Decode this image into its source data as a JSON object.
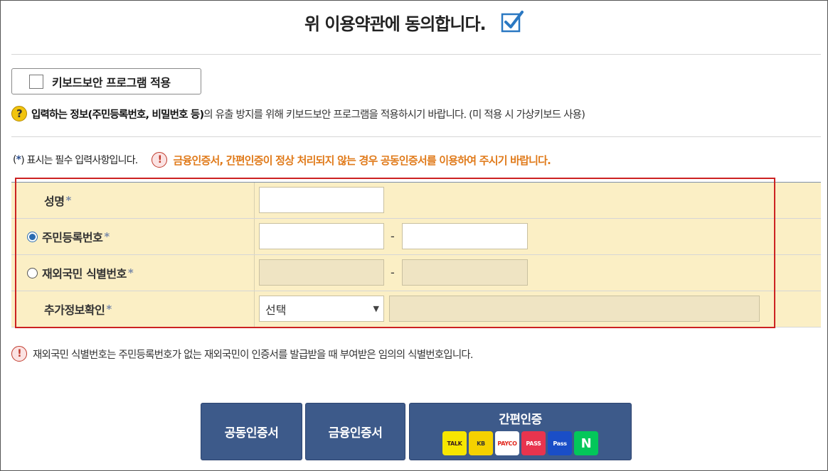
{
  "agree": {
    "title": "위 이용약관에 동의합니다.",
    "checked": true
  },
  "keyboard": {
    "label": "키보드보안 프로그램 적용"
  },
  "notice": {
    "icon": "question-icon",
    "bold": "입력하는 정보(주민등록번호, 비밀번호 등)",
    "rest": "의 유출 방지를 위해 키보드보안 프로그램을 적용하시기 바랍니다. (미 적용 시 가상키보드 사용)"
  },
  "required": {
    "paren_open": "(",
    "star": "*",
    "text": ") 표시는 필수 입력사항입니다.",
    "warning": "금융인증서, 간편인증이 정상 처리되지 않는 경우 공동인증서를 이용하여 주시기 바랍니다."
  },
  "form": {
    "name_label": "성명",
    "rrn_label": "주민등록번호",
    "foreign_label": "재외국민 식별번호",
    "extra_label": "추가정보확인",
    "star": "*",
    "dash": "-",
    "select_value": "선택"
  },
  "bottom_note": "재외국민 식별번호는 주민등록번호가 없는 재외국민이 인증서를 발급받을 때 부여받은 임의의 식별번호입니다.",
  "buttons": {
    "joint": "공동인증서",
    "finance": "금융인증서",
    "easy": "간편인증"
  },
  "providers": [
    {
      "name": "kakao-talk-logo",
      "text": "TALK",
      "bg": "#f7e600",
      "fg": "#3a1d1d"
    },
    {
      "name": "kb-logo",
      "text": "KB",
      "bg": "#f5d100",
      "fg": "#333333"
    },
    {
      "name": "payco-logo",
      "text": "PAYCO",
      "bg": "#ffffff",
      "fg": "#e1251b"
    },
    {
      "name": "pass-logo",
      "text": "PASS",
      "bg": "#e8344e",
      "fg": "#ffffff"
    },
    {
      "name": "samsung-pass-logo",
      "text": "Pass",
      "bg": "#1a4ec7",
      "fg": "#ffffff"
    },
    {
      "name": "naver-logo",
      "text": "N",
      "bg": "#03c75a",
      "fg": "#ffffff"
    }
  ],
  "colors": {
    "accent": "#3d5a8a",
    "form_bg": "#fbefc5",
    "highlight_border": "#cc2222",
    "warning_text": "#e07a1a"
  }
}
